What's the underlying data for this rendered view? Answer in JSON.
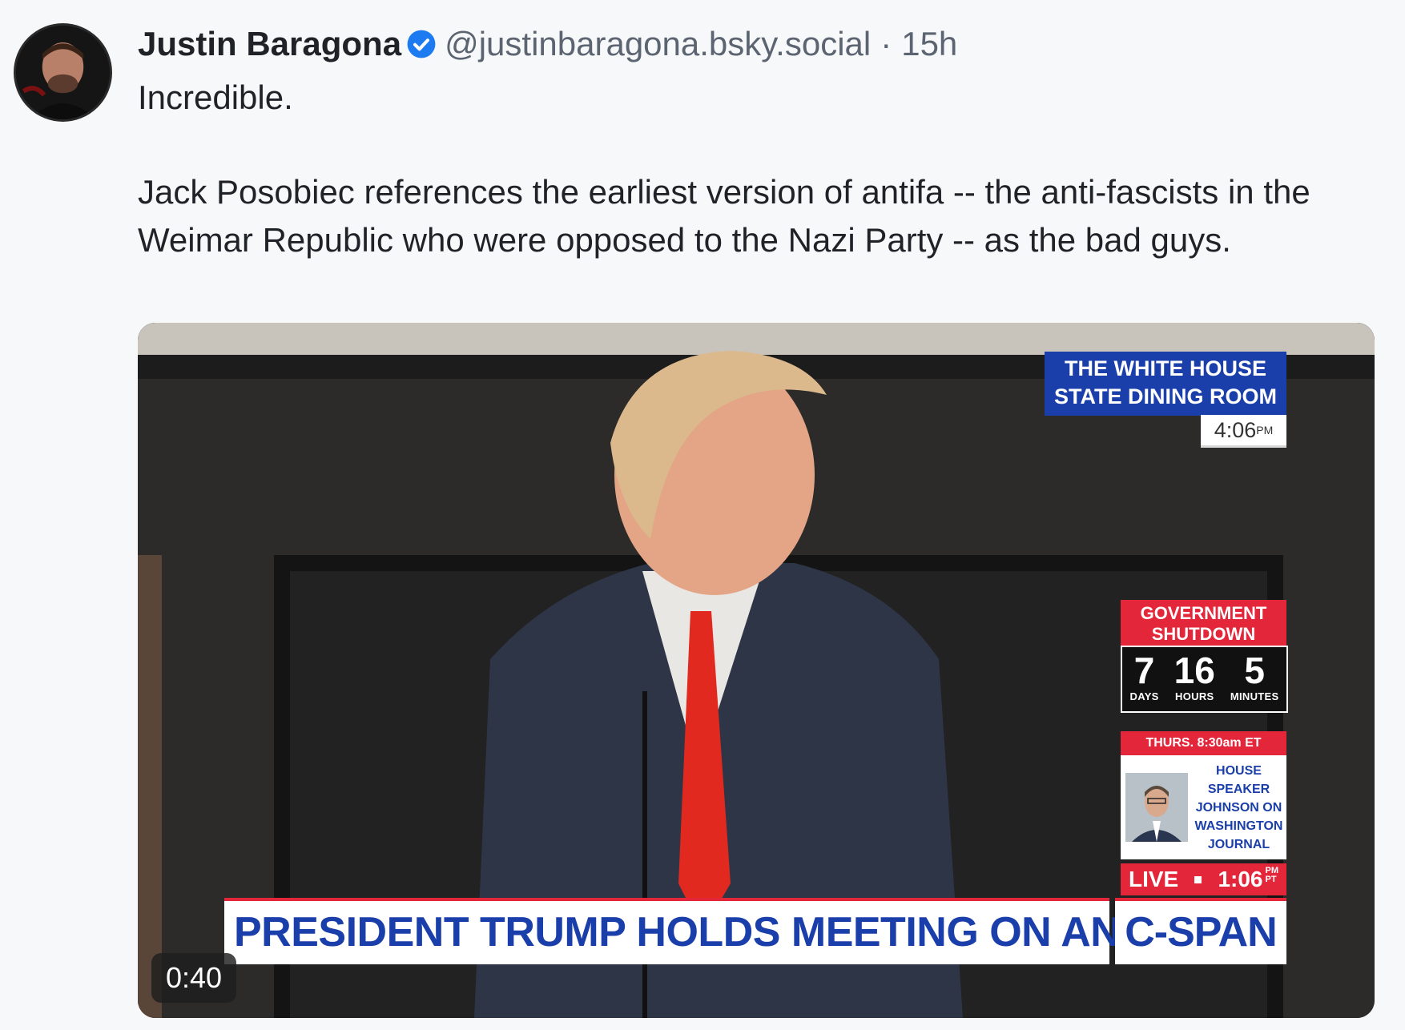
{
  "post": {
    "author_name": "Justin Baragona",
    "handle": "@justinbaragona.bsky.social",
    "separator": "·",
    "timestamp": "15h",
    "text_line1": "Incredible.",
    "text_line2": "Jack Posobiec references the earliest version of antifa -- the anti-fascists in the Weimar Republic who were opposed to the Nazi Party -- as the bad guys."
  },
  "video": {
    "duration": "0:40",
    "overlay": {
      "location_line1": "THE WHITE HOUSE",
      "location_line2": "STATE DINING ROOM",
      "clock_time": "4:06",
      "clock_suffix": "PM",
      "shutdown_line1": "GOVERNMENT",
      "shutdown_line2": "SHUTDOWN",
      "days_value": "7",
      "days_label": "DAYS",
      "hours_value": "16",
      "hours_label": "HOURS",
      "minutes_value": "5",
      "minutes_label": "MINUTES",
      "schedule_time": "THURS. 8:30am ET",
      "schedule_l1": "HOUSE",
      "schedule_l2": "SPEAKER",
      "schedule_l3": "JOHNSON ON",
      "schedule_l4": "WASHINGTON",
      "schedule_l5": "JOURNAL",
      "live_label": "LIVE",
      "live_time": "1:06",
      "live_tz1": "PM",
      "live_tz2": "PT",
      "headline": "PRESIDENT TRUMP HOLDS MEETING ON ANTIFA",
      "network_logo": "C-SPAN"
    }
  },
  "colors": {
    "verified_badge": "#1d7bf2",
    "cspan_blue": "#1b3faa",
    "cspan_red": "#e4263a"
  }
}
